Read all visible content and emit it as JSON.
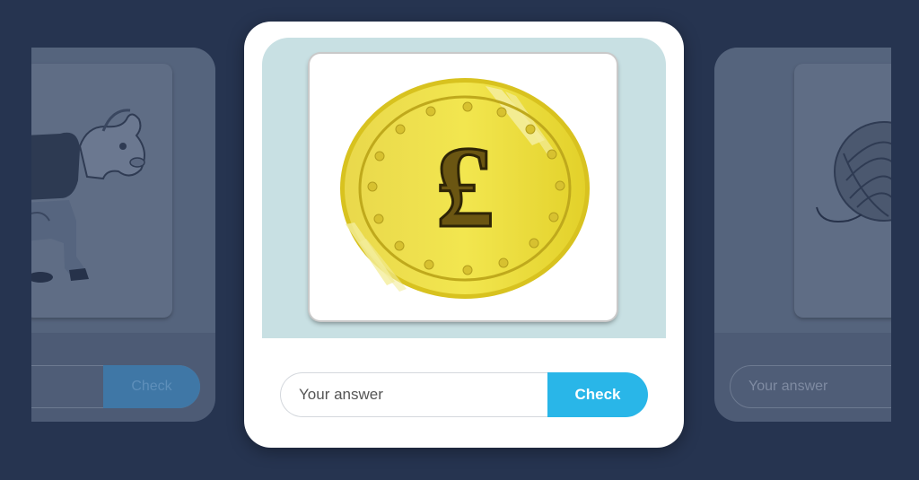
{
  "cards": {
    "previous": {
      "image_icon": "cow-icon",
      "button_label": "Check"
    },
    "current": {
      "image_icon": "pound-coin-icon",
      "coin_symbol": "£",
      "input_placeholder": "Your answer",
      "input_value": "",
      "button_label": "Check"
    },
    "next": {
      "image_icon": "yarn-ball-icon",
      "input_placeholder": "Your answer"
    }
  },
  "colors": {
    "background": "#263450",
    "card": "#ffffff",
    "image_area": "#c8e0e3",
    "check_button": "#29b6e8",
    "coin": "#e6d32a"
  }
}
